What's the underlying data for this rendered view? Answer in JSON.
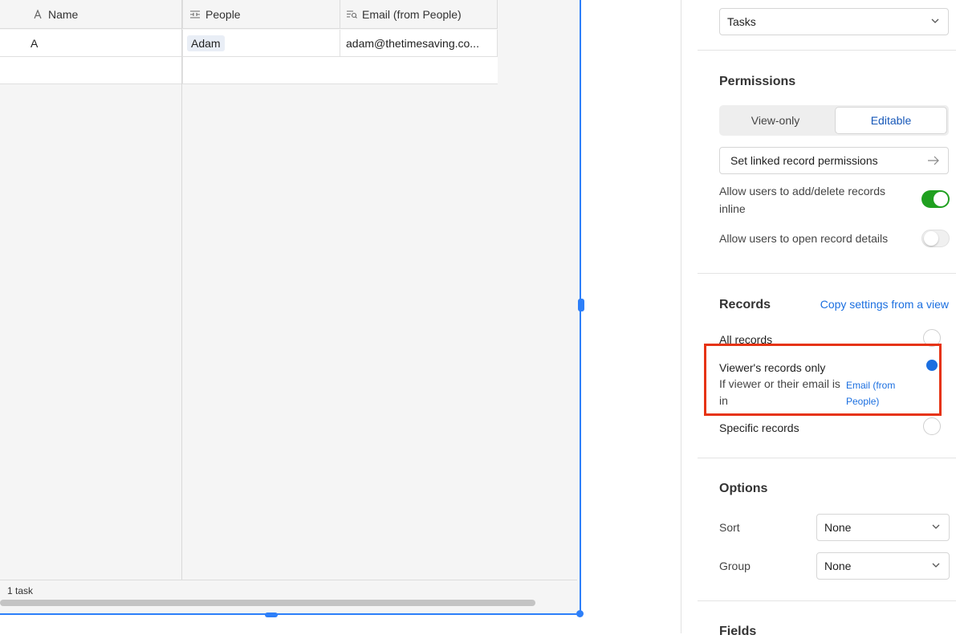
{
  "grid": {
    "columns": [
      {
        "label": "Name",
        "icon": "text-field-icon"
      },
      {
        "label": "People",
        "icon": "linked-record-icon"
      },
      {
        "label": "Email (from People)",
        "icon": "lookup-icon"
      }
    ],
    "rows": [
      {
        "name": "A",
        "people": "Adam",
        "email": "adam@thetimesaving.co..."
      },
      {
        "name": "",
        "people": "",
        "email": ""
      }
    ],
    "record_count": "1 task"
  },
  "panel": {
    "source_table": "Tasks",
    "permissions": {
      "title": "Permissions",
      "view_only_label": "View-only",
      "editable_label": "Editable",
      "linked_permissions_label": "Set linked record permissions",
      "allow_add_delete_label": "Allow users to add/delete records inline",
      "allow_add_delete_on": true,
      "allow_open_details_label": "Allow users to open record details",
      "allow_open_details_on": false
    },
    "records": {
      "title": "Records",
      "copy_settings_label": "Copy settings from a view",
      "all_records_label": "All records",
      "viewer_only_label": "Viewer's records only",
      "condition_text": "If viewer or their email is in",
      "condition_field": "Email (from People)",
      "specific_records_label": "Specific records",
      "selected": "viewer_only"
    },
    "options": {
      "title": "Options",
      "sort_label": "Sort",
      "sort_value": "None",
      "group_label": "Group",
      "group_value": "None"
    },
    "fields_title": "Fields"
  },
  "colors": {
    "accent_blue": "#1b6fe0",
    "toggle_on": "#20a020",
    "highlight_red": "#e63312",
    "selection_blue": "#2d7ff9"
  }
}
